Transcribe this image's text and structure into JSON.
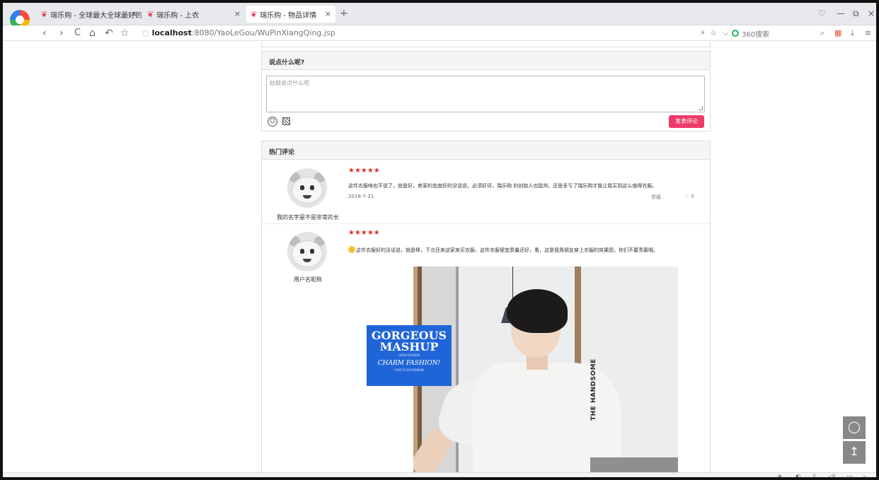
{
  "browser": {
    "tabs": [
      {
        "title": "瑞乐购 - 全球最大全球最好的!",
        "active": false
      },
      {
        "title": "瑞乐购 - 上衣",
        "active": false
      },
      {
        "title": "瑞乐购 - 物品详情",
        "active": true
      }
    ],
    "tab_close": "×",
    "new_tab": "+",
    "window_controls": {
      "skin": "♡",
      "minimize": "—",
      "maximize": "⧉",
      "close": "×"
    },
    "nav": {
      "back": "‹",
      "forward": "›",
      "reload": "C",
      "home": "⌂",
      "undo": "↶",
      "favorite": "☆"
    },
    "address": {
      "host": "localhost",
      "path": ":8080/YaoLeGou/WuPinXiangQing.jsp"
    },
    "right_icons": {
      "bolt": "⚡",
      "star": "☆",
      "dropdown": "⌵"
    },
    "search_engine": "360搜索",
    "toolbar_icons": {
      "search": "⌕",
      "apps": "▦",
      "download": "⤓",
      "menu": "≡"
    }
  },
  "comment_box": {
    "title": "说点什么呢?",
    "placeholder": "姑娘说点什么吧",
    "submit_label": "发表评论",
    "emoji_glyph": "☺"
  },
  "hot_comments": {
    "title": "热门评论",
    "items": [
      {
        "username": "我的名字是不是非常的长",
        "stars": "★★★★★",
        "text": "这件衣服啥也不说了，就是好，卖家的态度好的没话说，必须好评，瑞乐购 的创始人也挺帅。还是多亏了瑞乐购才能让我买到这么值得衣服。",
        "date": "2018-7-21",
        "report_label": "举报",
        "like_icon": "♡",
        "likes": "0"
      },
      {
        "username": "用户名昵称",
        "stars": "★★★★★",
        "text": "这件衣服好的没话说，就是棒，下次还来这家来买衣服，这件衣服便宜质量还好，看，这是我男朋友穿上衣服的效果图，你们不要羡慕哦。",
        "photo": {
          "promo_line1": "GORGEOUS",
          "promo_line2": "MASHUP",
          "promo_small1": "LOOK FASHION",
          "promo_line3": "CHARM FASHION!",
          "promo_small2": "THAT IS SO FASHION",
          "sleeve_text": "THE HANDSOME"
        }
      }
    ]
  },
  "floating": {
    "chat_icon": "◯",
    "top_icon": "↥"
  },
  "status_icons": [
    "✈",
    "◐",
    "▯",
    "◁)",
    "▭",
    "⌕"
  ]
}
